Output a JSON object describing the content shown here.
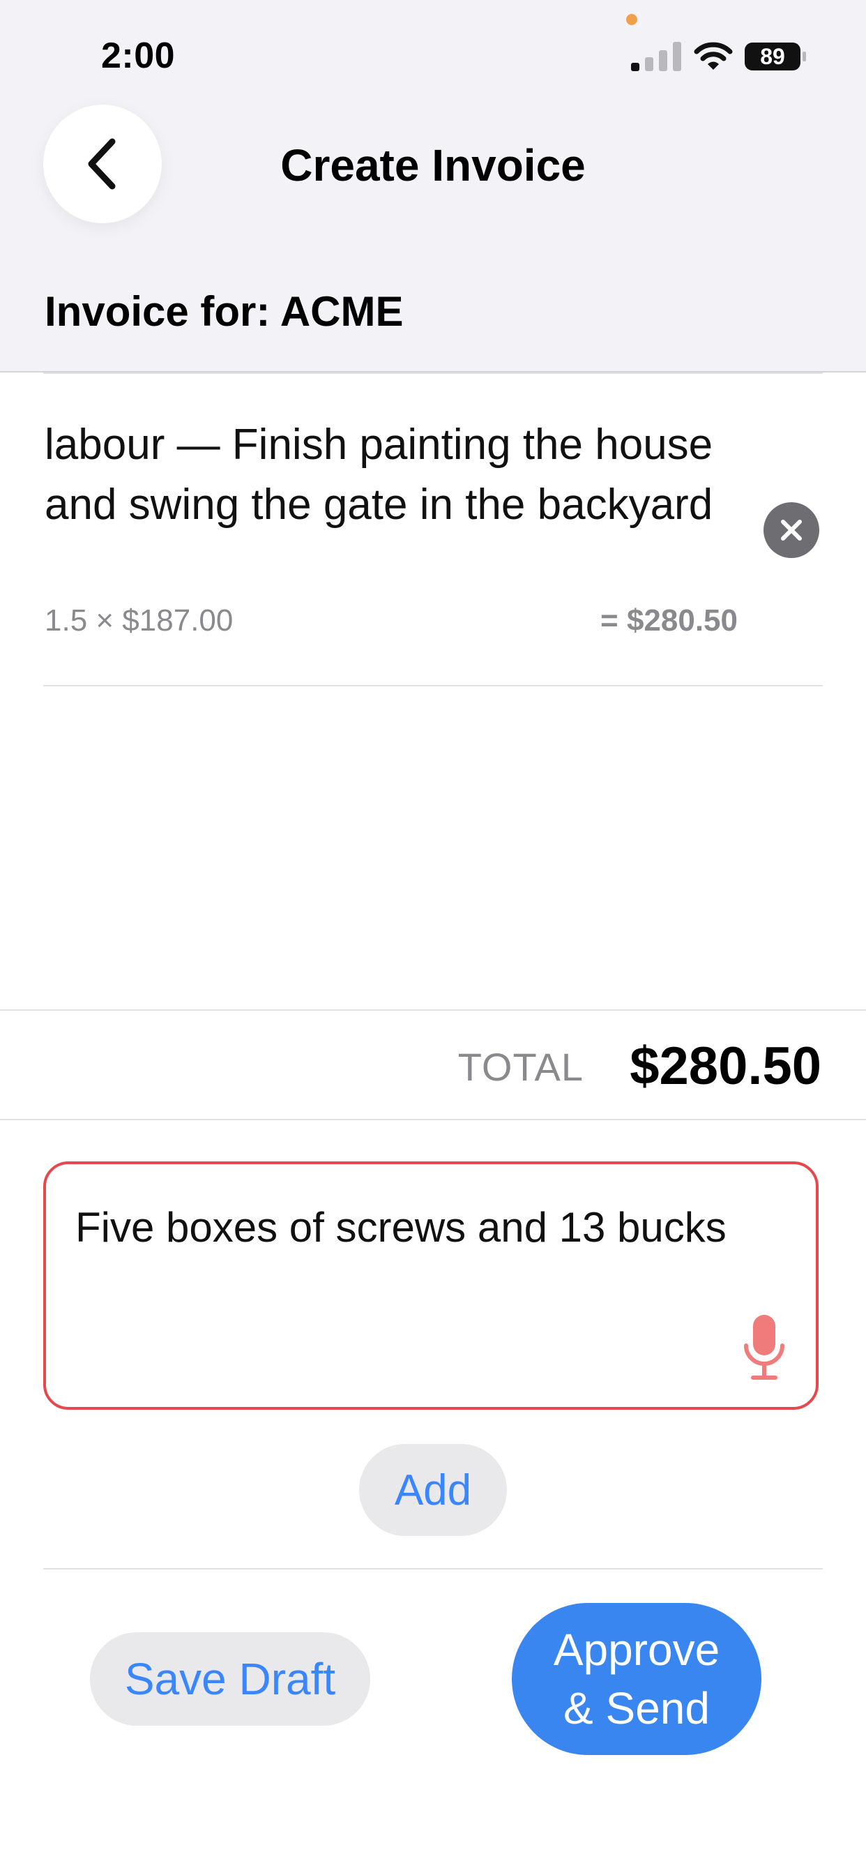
{
  "status_bar": {
    "time": "2:00",
    "battery": "89",
    "icons": [
      "signal-icon",
      "wifi-icon",
      "battery-icon"
    ]
  },
  "nav": {
    "back_icon": "chevron-left-icon",
    "title": "Create Invoice"
  },
  "invoice": {
    "for_label": "Invoice for: ACME"
  },
  "line_items": [
    {
      "description": "labour — Finish painting the house and swing the gate in the backyard",
      "quantity_price": "1.5 × $187.00",
      "line_total": "= $280.50",
      "remove_icon": "close-circle-icon"
    }
  ],
  "totals": {
    "label": "TOTAL",
    "value": "$280.50"
  },
  "input": {
    "value": "Five boxes of screws and 13 bucks",
    "mic_icon": "microphone-icon"
  },
  "actions": {
    "add_label": "Add",
    "save_draft_label": "Save Draft",
    "approve_send_label": "Approve\n& Send"
  },
  "colors": {
    "accent": "#3a86f0",
    "input_border": "#e5484d",
    "mic": "#ef7b7b",
    "header_bg": "#f2f2f7"
  }
}
